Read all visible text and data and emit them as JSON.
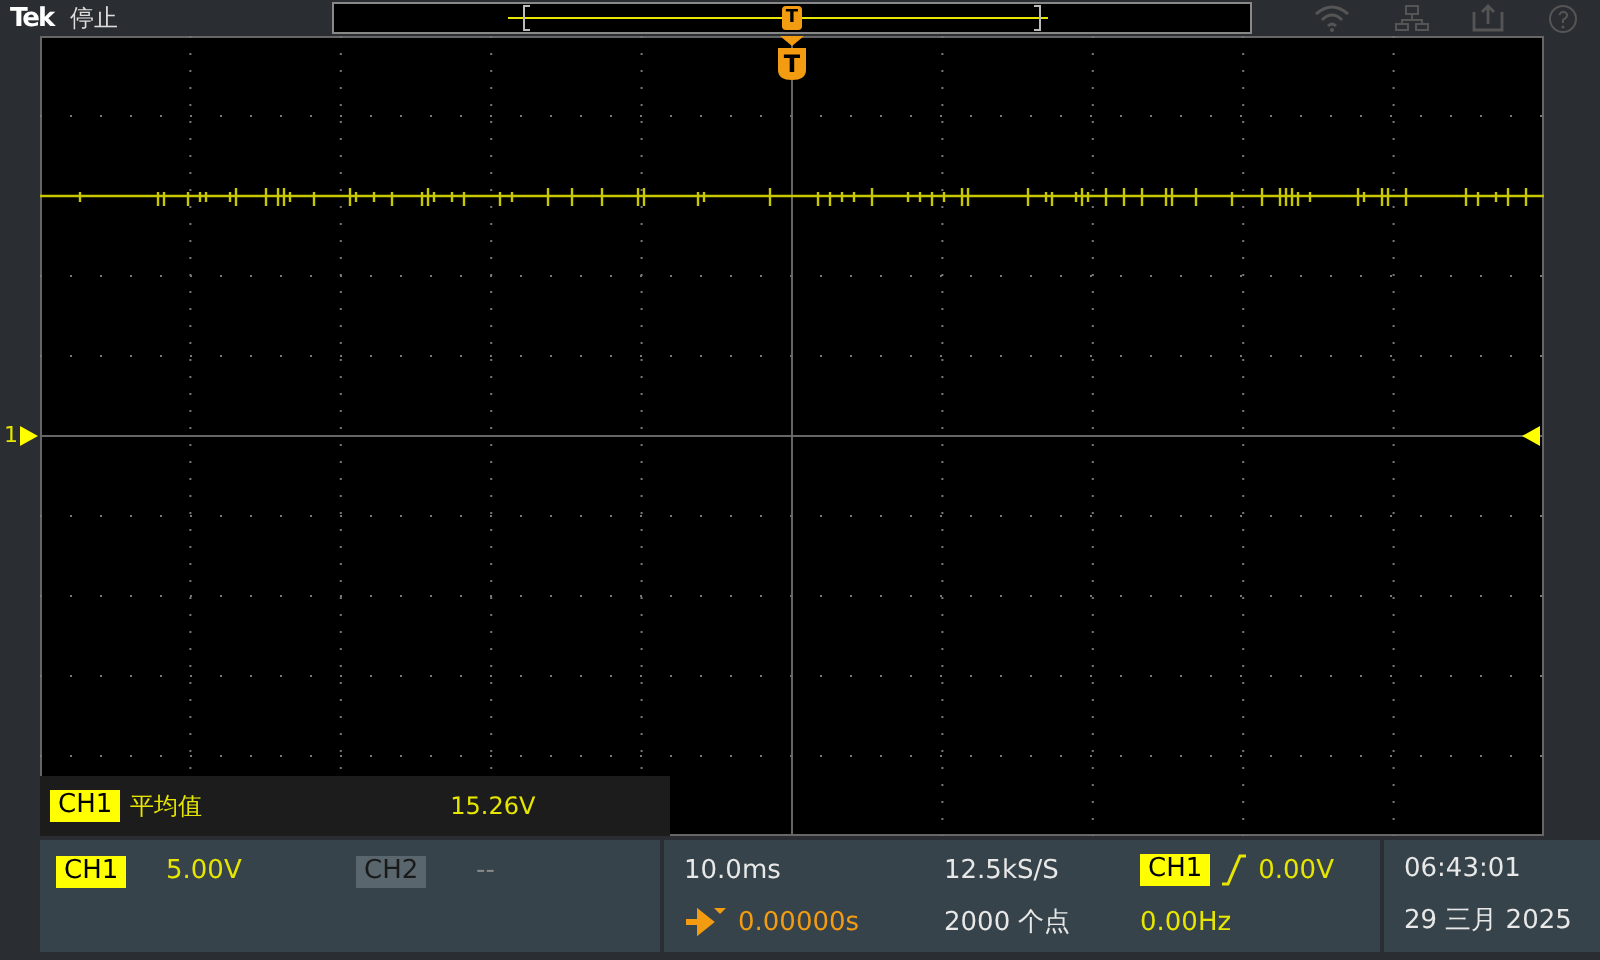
{
  "top_bar": {
    "brand": "Tek",
    "status": "停止"
  },
  "overview": {
    "trigger_label": "T"
  },
  "waveform": {
    "channel_label": "1",
    "trigger_label": "T"
  },
  "measurement": {
    "channel": "CH1",
    "name": "平均值",
    "value": "15.26V"
  },
  "channels": [
    {
      "label": "CH1",
      "scale": "5.00V",
      "on": true,
      "color": "#ffff00"
    },
    {
      "label": "CH2",
      "scale": "--",
      "on": false,
      "color": "#5a666d"
    }
  ],
  "horizontal": {
    "scale": "10.0ms",
    "position": "0.00000s",
    "sample_rate": "12.5kS/S",
    "points": "2000 个点"
  },
  "trigger": {
    "source": "CH1",
    "level": "0.00V",
    "frequency": "0.00Hz"
  },
  "clock": {
    "time": "06:43:01",
    "date": "29 三月 2025"
  }
}
